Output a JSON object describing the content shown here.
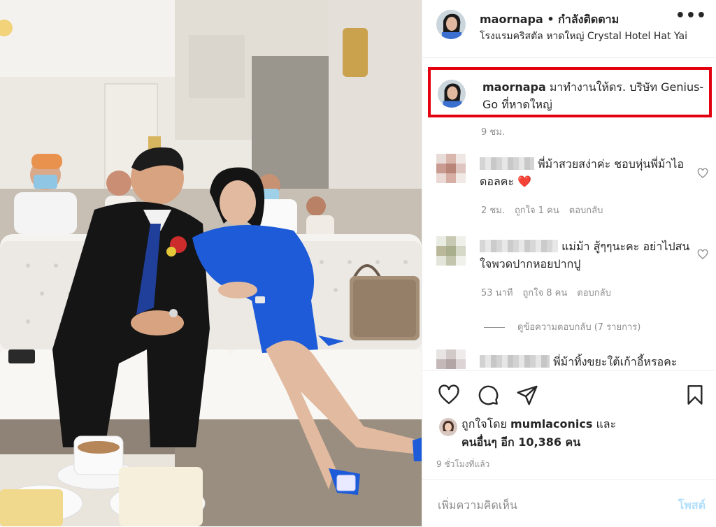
{
  "post": {
    "username": "maornapa",
    "separator": " • ",
    "follow_status": "กำลังติดตาม",
    "location": "โรงแรมคริสตัล หาดใหญ่ Crystal Hotel Hat Yai",
    "more_icon": "more-horizontal-icon"
  },
  "caption": {
    "username": "maornapa",
    "text": " มาทำงานให้ดร. บริษัท Genius-Go ที่หาดใหญ่",
    "time": "9 ชม.",
    "highlight_color": "#e3000f"
  },
  "comments": [
    {
      "text": "พี่ม้าสวยสง่าค่ะ ชอบหุ่นพี่ม้าไอดอลคะ ❤️",
      "time": "2 ชม.",
      "likes": "ถูกใจ 1 คน",
      "reply": "ตอบกลับ"
    },
    {
      "text": "แม่ม้า สู้ๆๆนะคะ อย่าไปสนใจพวดปากหอยปากปู",
      "time": "53 นาที",
      "likes": "ถูกใจ 8 คน",
      "reply": "ตอบกลับ"
    },
    {
      "text": "พี่ม้าทิ้งขยะใต้เก้าอี้หรอคะ"
    }
  ],
  "view_replies": "ดูข้อความตอบกลับ (7 รายการ)",
  "actions": {
    "like_icon": "heart-icon",
    "comment_icon": "comment-icon",
    "share_icon": "send-icon",
    "save_icon": "bookmark-icon"
  },
  "likes": {
    "prefix": "ถูกใจโดย ",
    "user": "mumlaconics",
    "conj": " และ",
    "others": "คนอื่นๆ อีก 10,386 คน"
  },
  "posted_ago": "9 ชั่วโมงที่แล้ว",
  "add_comment": {
    "placeholder": "เพิ่มความคิดเห็น",
    "post_label": "โพสต์"
  },
  "colors": {
    "highlight": "#e3000f",
    "muted": "#8e8e8e",
    "post_button": "#b2dffc",
    "heart_red": "#e0203a"
  }
}
